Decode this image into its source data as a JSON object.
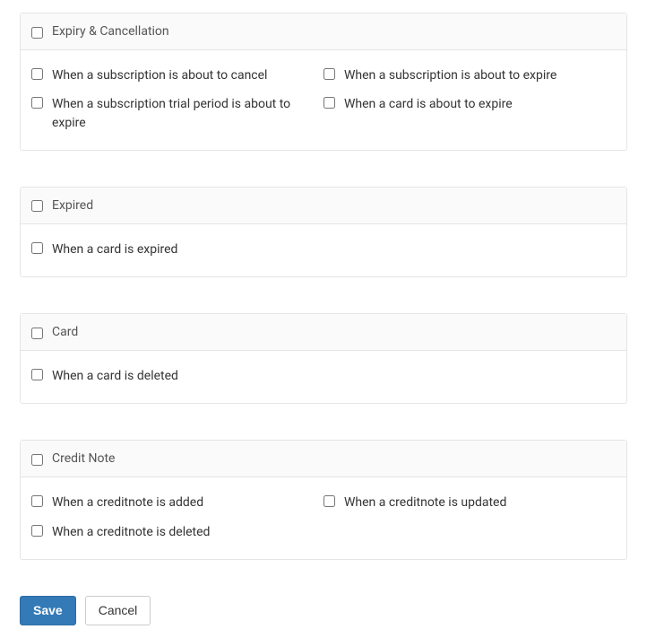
{
  "sections": [
    {
      "title": "Expiry & Cancellation",
      "items": [
        {
          "label": "When a subscription is about to cancel"
        },
        {
          "label": "When a subscription is about to expire"
        },
        {
          "label": "When a subscription trial period is about to expire"
        },
        {
          "label": "When a card is about to expire"
        }
      ]
    },
    {
      "title": "Expired",
      "items": [
        {
          "label": "When a card is expired"
        }
      ]
    },
    {
      "title": "Card",
      "items": [
        {
          "label": "When a card is deleted"
        }
      ]
    },
    {
      "title": "Credit Note",
      "items": [
        {
          "label": "When a creditnote is added"
        },
        {
          "label": "When a creditnote is updated"
        },
        {
          "label": "When a creditnote is deleted"
        }
      ]
    }
  ],
  "actions": {
    "save": "Save",
    "cancel": "Cancel"
  }
}
